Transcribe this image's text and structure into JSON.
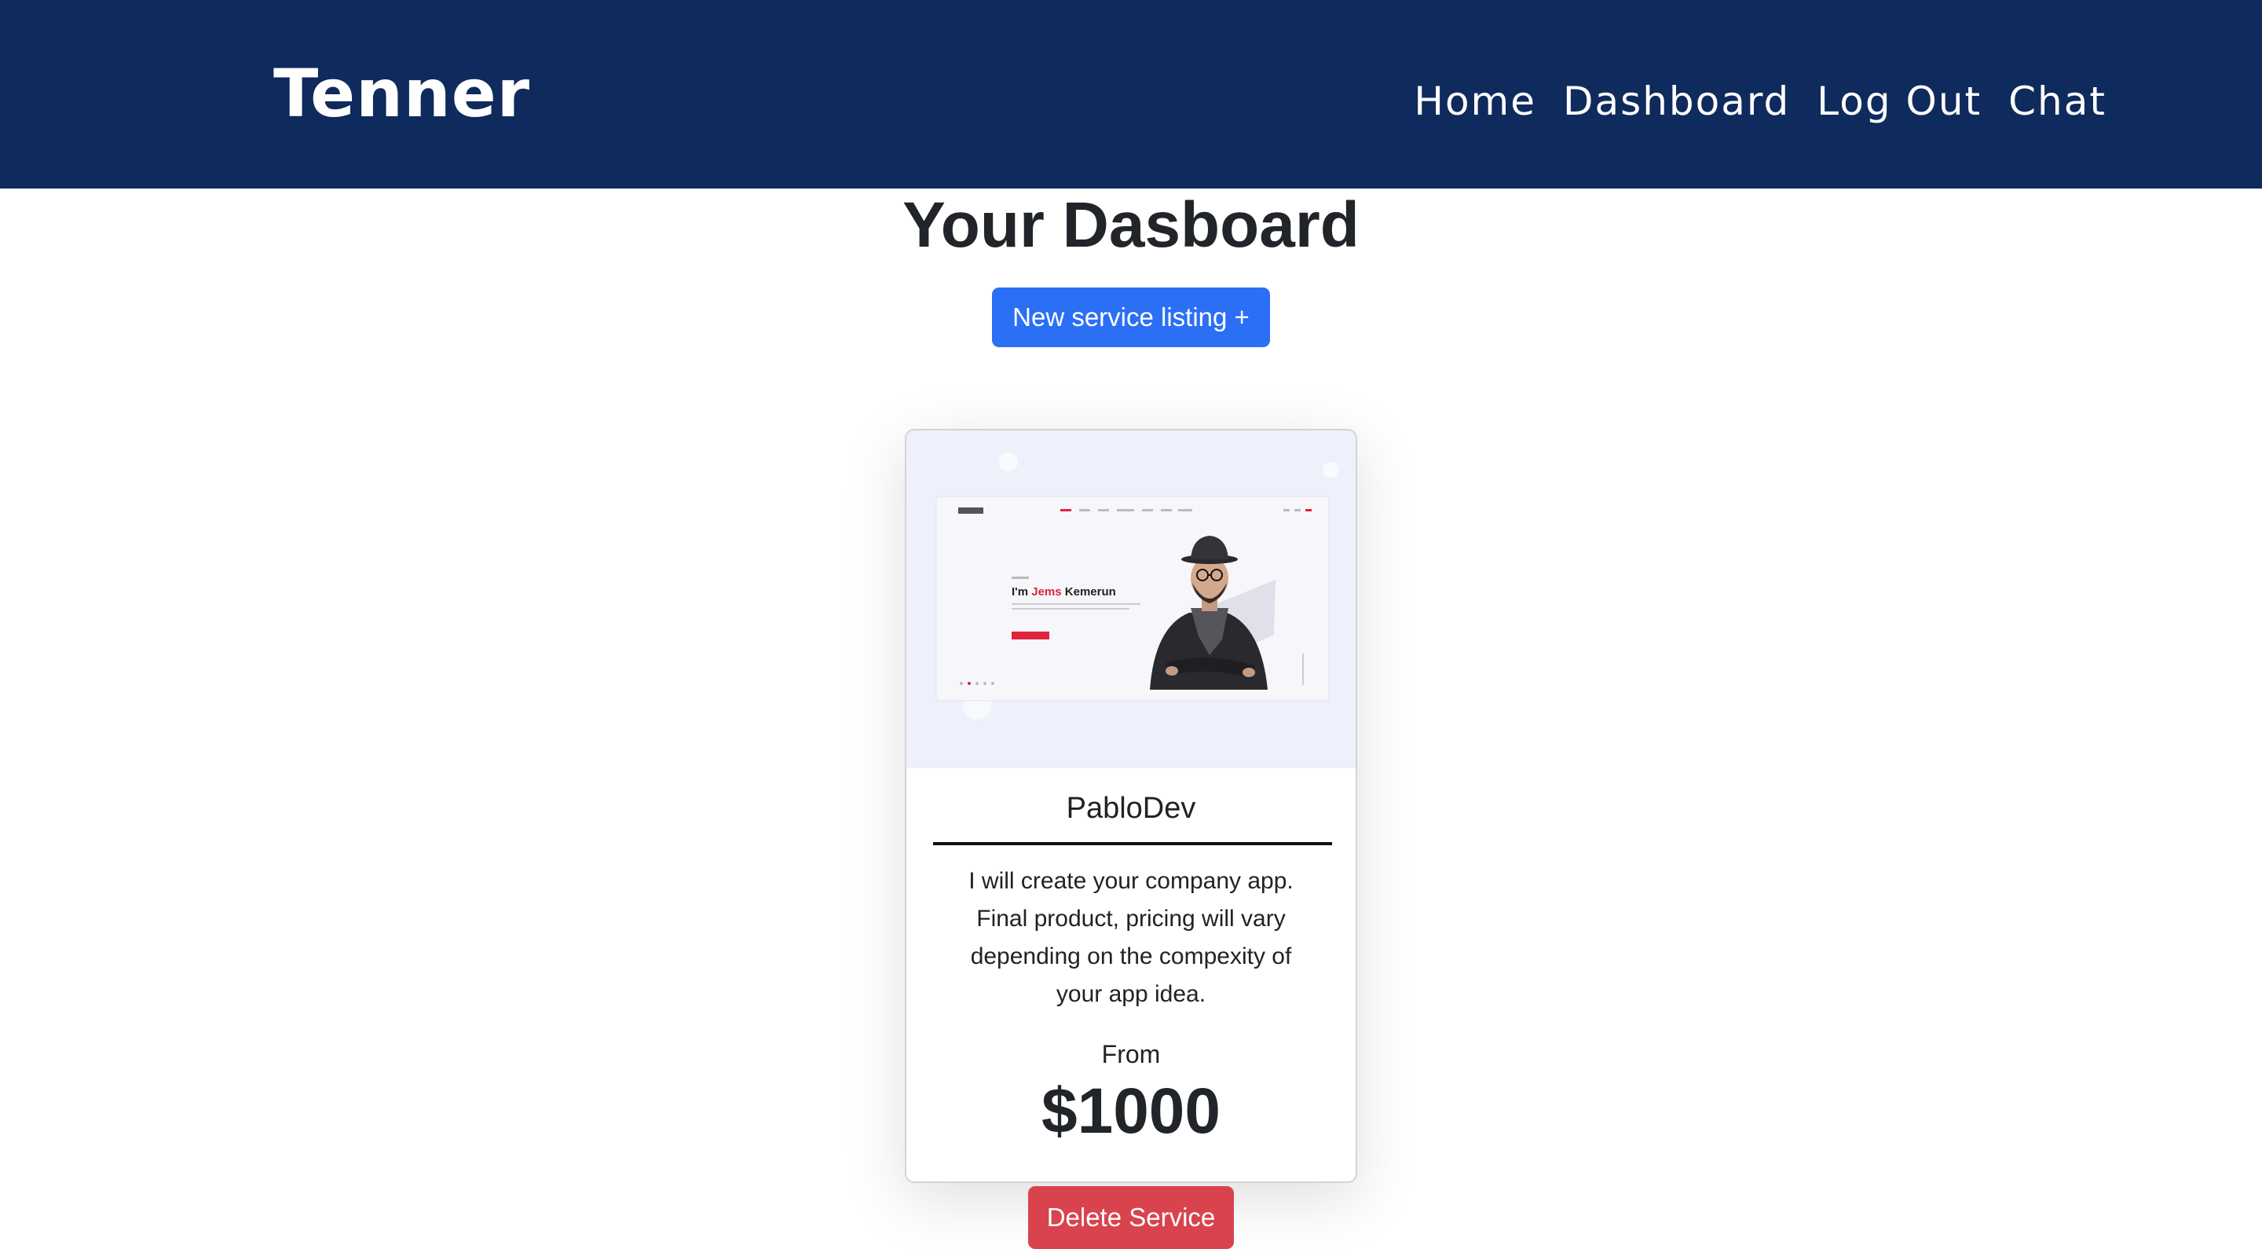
{
  "navbar": {
    "brand": "Tenner",
    "links": [
      "Home",
      "Dashboard",
      "Log Out",
      "Chat"
    ]
  },
  "page": {
    "title": "Your Dasboard",
    "new_listing_label": "New service listing +"
  },
  "service_card": {
    "image_text": {
      "greeting_prefix": "I'm ",
      "name_highlight": "Jems",
      "name_rest": " Kemerun"
    },
    "seller": "PabloDev",
    "description": "I will create your company app. Final product, pricing will vary depending on the compexity of your app idea.",
    "from_label": "From",
    "price": "$1000",
    "delete_label": "Delete Service"
  },
  "colors": {
    "navbar": "#0f2a5c",
    "primary_button": "#2b6ff5",
    "danger_button": "#d9434d",
    "card_image_bg": "#eef0fb",
    "highlight": "#e0243a"
  }
}
